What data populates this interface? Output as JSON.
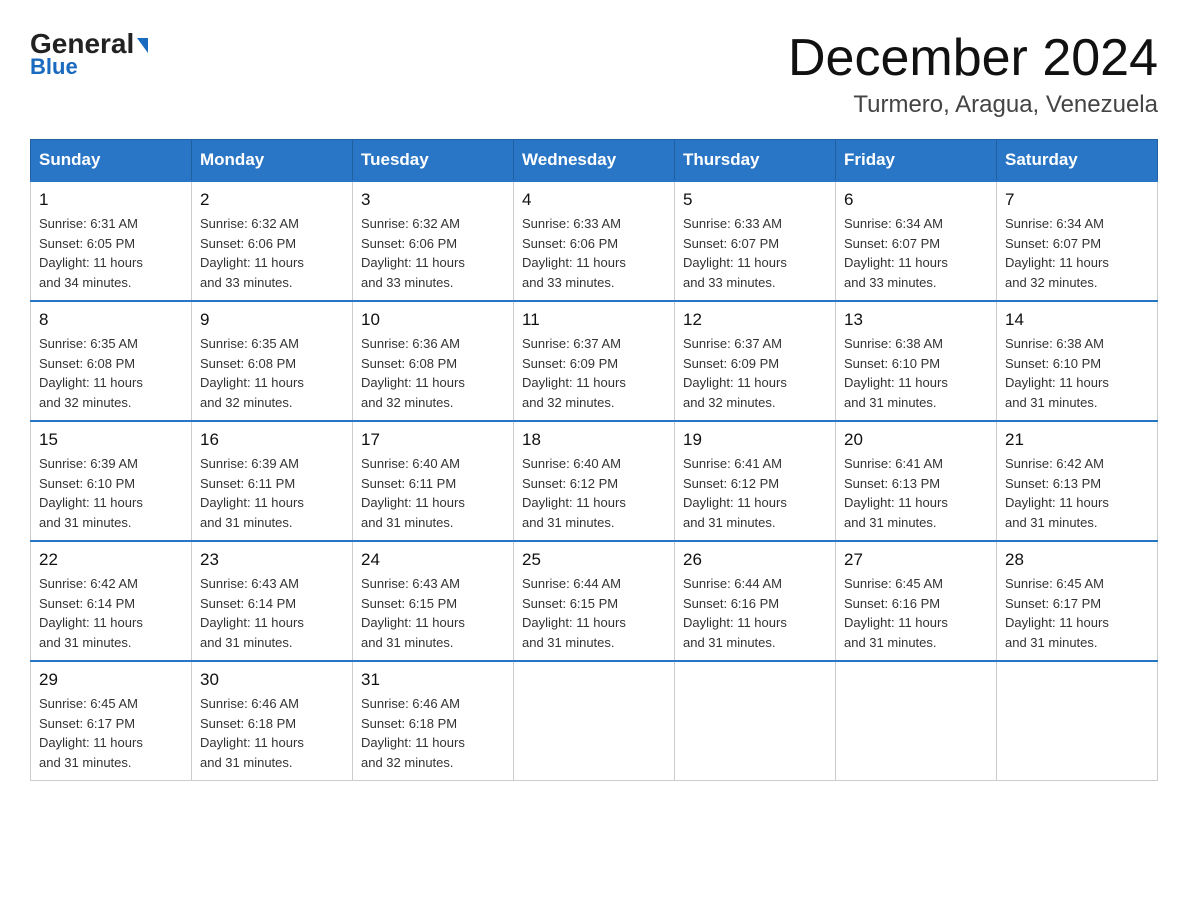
{
  "logo": {
    "general": "General",
    "blue": "Blue",
    "triangle": "▶"
  },
  "header": {
    "month_title": "December 2024",
    "location": "Turmero, Aragua, Venezuela"
  },
  "weekdays": [
    "Sunday",
    "Monday",
    "Tuesday",
    "Wednesday",
    "Thursday",
    "Friday",
    "Saturday"
  ],
  "weeks": [
    [
      {
        "day": "1",
        "sunrise": "6:31 AM",
        "sunset": "6:05 PM",
        "daylight": "11 hours and 34 minutes."
      },
      {
        "day": "2",
        "sunrise": "6:32 AM",
        "sunset": "6:06 PM",
        "daylight": "11 hours and 33 minutes."
      },
      {
        "day": "3",
        "sunrise": "6:32 AM",
        "sunset": "6:06 PM",
        "daylight": "11 hours and 33 minutes."
      },
      {
        "day": "4",
        "sunrise": "6:33 AM",
        "sunset": "6:06 PM",
        "daylight": "11 hours and 33 minutes."
      },
      {
        "day": "5",
        "sunrise": "6:33 AM",
        "sunset": "6:07 PM",
        "daylight": "11 hours and 33 minutes."
      },
      {
        "day": "6",
        "sunrise": "6:34 AM",
        "sunset": "6:07 PM",
        "daylight": "11 hours and 33 minutes."
      },
      {
        "day": "7",
        "sunrise": "6:34 AM",
        "sunset": "6:07 PM",
        "daylight": "11 hours and 32 minutes."
      }
    ],
    [
      {
        "day": "8",
        "sunrise": "6:35 AM",
        "sunset": "6:08 PM",
        "daylight": "11 hours and 32 minutes."
      },
      {
        "day": "9",
        "sunrise": "6:35 AM",
        "sunset": "6:08 PM",
        "daylight": "11 hours and 32 minutes."
      },
      {
        "day": "10",
        "sunrise": "6:36 AM",
        "sunset": "6:08 PM",
        "daylight": "11 hours and 32 minutes."
      },
      {
        "day": "11",
        "sunrise": "6:37 AM",
        "sunset": "6:09 PM",
        "daylight": "11 hours and 32 minutes."
      },
      {
        "day": "12",
        "sunrise": "6:37 AM",
        "sunset": "6:09 PM",
        "daylight": "11 hours and 32 minutes."
      },
      {
        "day": "13",
        "sunrise": "6:38 AM",
        "sunset": "6:10 PM",
        "daylight": "11 hours and 31 minutes."
      },
      {
        "day": "14",
        "sunrise": "6:38 AM",
        "sunset": "6:10 PM",
        "daylight": "11 hours and 31 minutes."
      }
    ],
    [
      {
        "day": "15",
        "sunrise": "6:39 AM",
        "sunset": "6:10 PM",
        "daylight": "11 hours and 31 minutes."
      },
      {
        "day": "16",
        "sunrise": "6:39 AM",
        "sunset": "6:11 PM",
        "daylight": "11 hours and 31 minutes."
      },
      {
        "day": "17",
        "sunrise": "6:40 AM",
        "sunset": "6:11 PM",
        "daylight": "11 hours and 31 minutes."
      },
      {
        "day": "18",
        "sunrise": "6:40 AM",
        "sunset": "6:12 PM",
        "daylight": "11 hours and 31 minutes."
      },
      {
        "day": "19",
        "sunrise": "6:41 AM",
        "sunset": "6:12 PM",
        "daylight": "11 hours and 31 minutes."
      },
      {
        "day": "20",
        "sunrise": "6:41 AM",
        "sunset": "6:13 PM",
        "daylight": "11 hours and 31 minutes."
      },
      {
        "day": "21",
        "sunrise": "6:42 AM",
        "sunset": "6:13 PM",
        "daylight": "11 hours and 31 minutes."
      }
    ],
    [
      {
        "day": "22",
        "sunrise": "6:42 AM",
        "sunset": "6:14 PM",
        "daylight": "11 hours and 31 minutes."
      },
      {
        "day": "23",
        "sunrise": "6:43 AM",
        "sunset": "6:14 PM",
        "daylight": "11 hours and 31 minutes."
      },
      {
        "day": "24",
        "sunrise": "6:43 AM",
        "sunset": "6:15 PM",
        "daylight": "11 hours and 31 minutes."
      },
      {
        "day": "25",
        "sunrise": "6:44 AM",
        "sunset": "6:15 PM",
        "daylight": "11 hours and 31 minutes."
      },
      {
        "day": "26",
        "sunrise": "6:44 AM",
        "sunset": "6:16 PM",
        "daylight": "11 hours and 31 minutes."
      },
      {
        "day": "27",
        "sunrise": "6:45 AM",
        "sunset": "6:16 PM",
        "daylight": "11 hours and 31 minutes."
      },
      {
        "day": "28",
        "sunrise": "6:45 AM",
        "sunset": "6:17 PM",
        "daylight": "11 hours and 31 minutes."
      }
    ],
    [
      {
        "day": "29",
        "sunrise": "6:45 AM",
        "sunset": "6:17 PM",
        "daylight": "11 hours and 31 minutes."
      },
      {
        "day": "30",
        "sunrise": "6:46 AM",
        "sunset": "6:18 PM",
        "daylight": "11 hours and 31 minutes."
      },
      {
        "day": "31",
        "sunrise": "6:46 AM",
        "sunset": "6:18 PM",
        "daylight": "11 hours and 32 minutes."
      },
      null,
      null,
      null,
      null
    ]
  ],
  "labels": {
    "sunrise": "Sunrise:",
    "sunset": "Sunset:",
    "daylight": "Daylight:"
  }
}
